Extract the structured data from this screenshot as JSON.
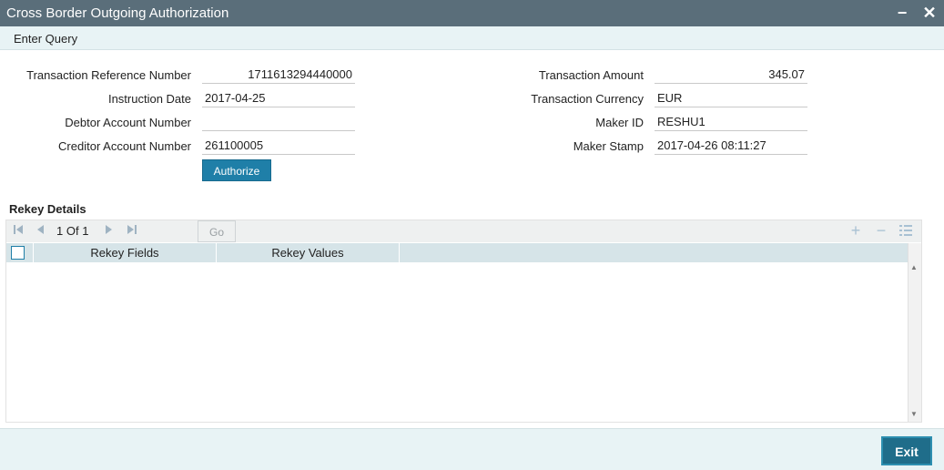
{
  "window": {
    "title": "Cross Border Outgoing Authorization",
    "minimize_label": "−",
    "close_label": "✕"
  },
  "menu": {
    "enter_query": "Enter Query"
  },
  "form": {
    "txn_ref_label": "Transaction Reference Number",
    "txn_ref_value": "1711613294440000",
    "instr_date_label": "Instruction Date",
    "instr_date_value": "2017-04-25",
    "debtor_acc_label": "Debtor Account Number",
    "debtor_acc_value": "",
    "creditor_acc_label": "Creditor Account Number",
    "creditor_acc_value": "261100005",
    "txn_amount_label": "Transaction Amount",
    "txn_amount_value": "345.07",
    "txn_currency_label": "Transaction Currency",
    "txn_currency_value": "EUR",
    "maker_id_label": "Maker ID",
    "maker_id_value": "RESHU1",
    "maker_stamp_label": "Maker Stamp",
    "maker_stamp_value": "2017-04-26 08:11:27",
    "authorize_label": "Authorize"
  },
  "rekey": {
    "section_title": "Rekey Details",
    "page_current": "1",
    "page_of": "Of",
    "page_total": "1",
    "go_label": "Go",
    "columns": [
      "Rekey Fields",
      "Rekey Values"
    ],
    "rows": []
  },
  "footer": {
    "exit_label": "Exit"
  },
  "icons": {
    "first": "first-page-icon",
    "prev": "prev-page-icon",
    "next": "next-page-icon",
    "last": "last-page-icon",
    "add": "add-row-icon",
    "remove": "delete-row-icon",
    "columns": "column-settings-icon"
  },
  "colors": {
    "titlebar": "#5a6e7a",
    "accent": "#1f7fa8",
    "exit_button": "#1f6d8a",
    "grid_header": "#d6e4e8"
  }
}
